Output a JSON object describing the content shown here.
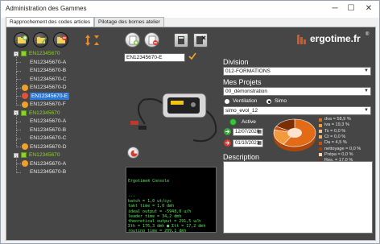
{
  "window": {
    "title": "Administration des Gammes",
    "min_glyph": "─",
    "max_glyph": "☐",
    "close_glyph": "✕"
  },
  "tabs": [
    {
      "label": "Rapprochement des codes articles",
      "active": true
    },
    {
      "label": "Pilotage des bornes atelier",
      "active": false
    }
  ],
  "logo": {
    "text": "ergotime.fr",
    "reg": "®"
  },
  "tree": [
    {
      "label": "EN12345670",
      "level": 0,
      "color": "green",
      "expander": "-"
    },
    {
      "label": "EN12345670-A",
      "level": 1,
      "icon": "none"
    },
    {
      "label": "EN12345670-B",
      "level": 1,
      "icon": "none"
    },
    {
      "label": "EN12345670-C",
      "level": 1,
      "icon": "none"
    },
    {
      "label": "EN12345670-D",
      "level": 1,
      "icon": "orange"
    },
    {
      "label": "EN12345670-E",
      "level": 1,
      "icon": "red",
      "selected": true
    },
    {
      "label": "EN12345670-F",
      "level": 1,
      "icon": "orange"
    },
    {
      "label": "EN12345670",
      "level": 0,
      "color": "green",
      "expander": "-"
    },
    {
      "label": "EN12345670-A",
      "level": 1,
      "icon": "none"
    },
    {
      "label": "EN12345670-B",
      "level": 1,
      "icon": "none"
    },
    {
      "label": "EN12345670-C",
      "level": 1,
      "icon": "none"
    },
    {
      "label": "EN12345670-D",
      "level": 1,
      "icon": "orange"
    },
    {
      "label": "EN12345670",
      "level": 0,
      "color": "green",
      "expander": "-"
    },
    {
      "label": "EN12345670-A",
      "level": 1,
      "icon": "orange"
    },
    {
      "label": "EN12345670-B",
      "level": 1,
      "icon": "none"
    }
  ],
  "article": {
    "code": "EN12345670-E"
  },
  "form": {
    "division_label": "Division",
    "division_value": "012-FORMATIONS",
    "projets_label": "Mes Projets",
    "projets_value": "00_démonstration",
    "radio_ventilation": "Ventilation",
    "radio_simo": "Simo",
    "simo_value": "simo_evol_12",
    "active_label": "Active",
    "date_start": "12/07/2020",
    "date_end": "01/10/2021",
    "description_label": "Description",
    "description_value": ""
  },
  "console": {
    "title": "Ergotime® Console",
    "lines": [
      "---",
      "batch = 1,0 ut/cyc",
      "takt time = 1,0 dmh",
      "ideal output = -5948,0 u/h",
      "leader time = 34,2 dmh",
      "theoretical output = 291,5 u/h",
      "Σth = 176,3 dmh ■ Σtt = 17,2 dmh",
      "routing time = 209,1 dmh",
      "workforce = 0 ■ ergo load = 93,0 %",
      "---"
    ]
  },
  "chart_data": {
    "type": "pie",
    "categories": [
      "dva",
      "iva",
      "Ts",
      "Ct",
      "Da",
      "nettoyage",
      "Prépa",
      "Res."
    ],
    "values": [
      58.9,
      19.3,
      0.0,
      0.0,
      4.5,
      0.0,
      0.0,
      17.0
    ],
    "labels": [
      "dva = 58,9 %",
      "iva = 19,3 %",
      "Ts = 0,0 %",
      "Ct = 0,0 %",
      "Da = 4,5 %",
      "nettoyage = 0,0 %",
      "Prépa = 0,0 %",
      "Res. = 17,0 %"
    ],
    "colors": [
      "#e36a17",
      "#f39a3c",
      "#f7c08a",
      "#f2b063",
      "#c84f0c",
      "#9e3d08",
      "#fbd9b5",
      "#7a2f07"
    ],
    "title": "",
    "legend": "right"
  }
}
